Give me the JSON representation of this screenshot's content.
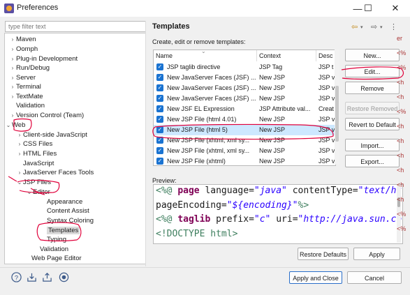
{
  "window": {
    "title": "Preferences",
    "min_glyph": "—",
    "max_glyph": "☐",
    "close_glyph": "✕"
  },
  "filter": {
    "placeholder": "type filter text"
  },
  "tree": {
    "items": [
      {
        "label": "Maven",
        "arrow": "›"
      },
      {
        "label": "Oomph",
        "arrow": "›"
      },
      {
        "label": "Plug-in Development",
        "arrow": "›"
      },
      {
        "label": "Run/Debug",
        "arrow": "›"
      },
      {
        "label": "Server",
        "arrow": "›"
      },
      {
        "label": "Terminal",
        "arrow": "›"
      },
      {
        "label": "TextMate",
        "arrow": "›"
      },
      {
        "label": "Validation",
        "arrow": ""
      },
      {
        "label": "Version Control (Team)",
        "arrow": "›"
      },
      {
        "label": "Web",
        "arrow": "⌄"
      },
      {
        "label": "Client-side JavaScript",
        "arrow": "›"
      },
      {
        "label": "CSS Files",
        "arrow": "›"
      },
      {
        "label": "HTML Files",
        "arrow": "›"
      },
      {
        "label": "JavaScript",
        "arrow": ""
      },
      {
        "label": "JavaServer Faces Tools",
        "arrow": "›"
      },
      {
        "label": "JSP Files",
        "arrow": "⌄"
      },
      {
        "label": "Editor",
        "arrow": "⌄"
      },
      {
        "label": "Appearance",
        "arrow": ""
      },
      {
        "label": "Content Assist",
        "arrow": ""
      },
      {
        "label": "Syntax Coloring",
        "arrow": ""
      },
      {
        "label": "Templates",
        "arrow": ""
      },
      {
        "label": "Typing",
        "arrow": ""
      },
      {
        "label": "Validation",
        "arrow": ""
      },
      {
        "label": "Web Page Editor",
        "arrow": ""
      }
    ]
  },
  "panel": {
    "title": "Templates",
    "subtitle": "Create, edit or remove templates:",
    "back_glyph": "⇦",
    "fwd_glyph": "⇨",
    "menu_glyph": "⋮"
  },
  "table": {
    "columns": [
      "Name",
      "Context",
      "Desc"
    ],
    "rows": [
      {
        "name": "JSP taglib directive",
        "context": "JSP Tag",
        "desc": "JSP t"
      },
      {
        "name": "New JavaServer Faces (JSF) ...",
        "context": "New JSP",
        "desc": "JSP v"
      },
      {
        "name": "New JavaServer Faces (JSF) ...",
        "context": "New JSP",
        "desc": "JSP v"
      },
      {
        "name": "New JavaServer Faces (JSF) ...",
        "context": "New JSP",
        "desc": "JSP v"
      },
      {
        "name": "New JSF EL Expression",
        "context": "JSP Attribute val...",
        "desc": "Creat"
      },
      {
        "name": "New JSP File (html 4.01)",
        "context": "New JSP",
        "desc": "JSP v"
      },
      {
        "name": "New JSP File (html 5)",
        "context": "New JSP",
        "desc": "JSP v"
      },
      {
        "name": "New JSP File (xhtml, xml sy...",
        "context": "New JSP",
        "desc": "JSP v"
      },
      {
        "name": "New JSP File (xhtml, xml sy...",
        "context": "New JSP",
        "desc": "JSP v"
      },
      {
        "name": "New JSP File (xhtml)",
        "context": "New JSP",
        "desc": "JSP v"
      }
    ]
  },
  "buttons": {
    "new": "New...",
    "edit": "Edit...",
    "remove": "Remove",
    "restore_removed": "Restore Removed",
    "revert": "Revert to Default",
    "import": "Import...",
    "export": "Export...",
    "restore_defaults": "Restore Defaults",
    "apply": "Apply",
    "apply_close": "Apply and Close",
    "cancel": "Cancel"
  },
  "preview": {
    "label": "Preview:",
    "lines": [
      [
        "<%@ ",
        "page ",
        "language",
        "=",
        "\"java\" ",
        "contentType",
        "=",
        "\"text/ht"
      ],
      [
        "    ",
        "",
        "pageEncoding",
        "=",
        "\"${encoding}\"",
        "",
        "",
        "%>"
      ],
      [
        "<%@ ",
        "taglib ",
        "prefix",
        "=",
        "\"c\" ",
        "uri",
        "=",
        "\"http://java.sun.co"
      ],
      [
        "<!DOCTYPE html>",
        "",
        "",
        "",
        "",
        "",
        "",
        ""
      ]
    ]
  },
  "edge_glyphs": [
    "er",
    "<%",
    "<%",
    "<h",
    "<h",
    "<%",
    "<h",
    "<h",
    "<h",
    "<h",
    "<h",
    "<h",
    "<%",
    "<%"
  ],
  "colors": {
    "selection": "#cde8ff",
    "checkbox": "#1a73d1",
    "annotation": "#e0003a",
    "keyword": "#7f0055",
    "string": "#2a00ff"
  }
}
